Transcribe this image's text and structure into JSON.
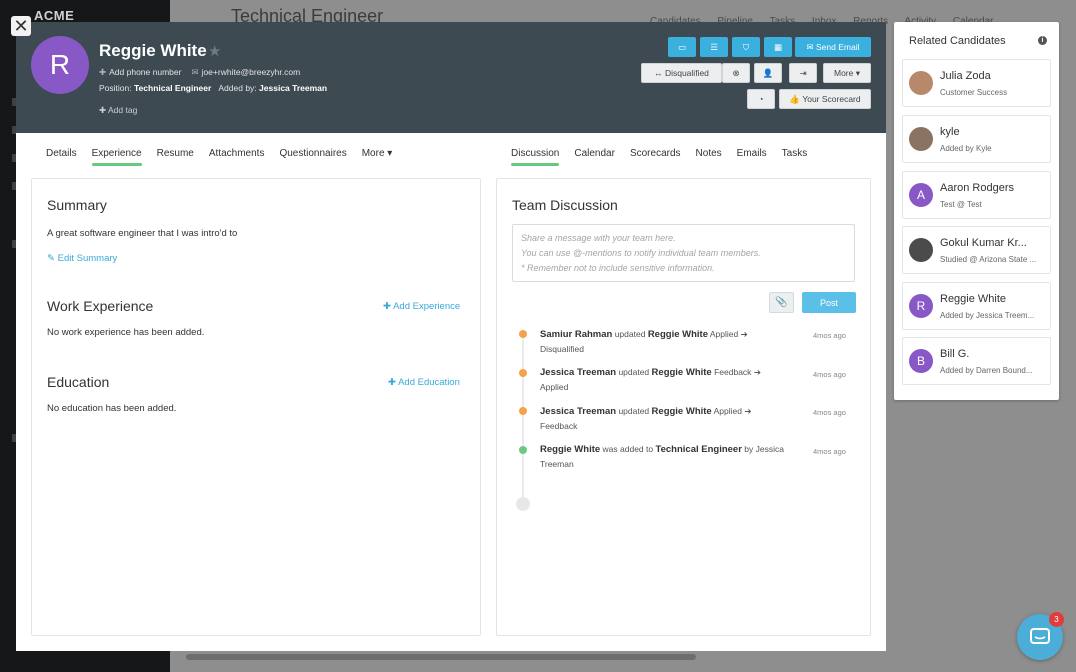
{
  "background": {
    "logo": "ACME",
    "page_title": "Technical Engineer",
    "nav": [
      "Candidates",
      "Pipeline",
      "Tasks",
      "Inbox",
      "Reports",
      "Activity",
      "Calendar"
    ]
  },
  "candidate": {
    "initial": "R",
    "name": "Reggie White",
    "phone_placeholder": "Add phone number",
    "email": "joe+rwhite@breezyhr.com",
    "position_label": "Position:",
    "position": "Technical Engineer",
    "added_by_label": "Added by:",
    "added_by": "Jessica Treeman",
    "add_tag": "Add tag"
  },
  "header_actions": {
    "send_email": "Send Email",
    "status": "Disqualified",
    "more": "More",
    "scorecard": "Your Scorecard"
  },
  "left_tabs": [
    {
      "label": "Details"
    },
    {
      "label": "Experience"
    },
    {
      "label": "Resume"
    },
    {
      "label": "Attachments"
    },
    {
      "label": "Questionnaires"
    },
    {
      "label": "More ▾"
    }
  ],
  "right_tabs": [
    {
      "label": "Discussion"
    },
    {
      "label": "Calendar"
    },
    {
      "label": "Scorecards"
    },
    {
      "label": "Notes"
    },
    {
      "label": "Emails"
    },
    {
      "label": "Tasks"
    }
  ],
  "summary": {
    "title": "Summary",
    "text": "A great software engineer that I was intro'd to",
    "edit_link": "Edit Summary"
  },
  "work_experience": {
    "title": "Work Experience",
    "add_link": "Add Experience",
    "empty": "No work experience has been added."
  },
  "education": {
    "title": "Education",
    "add_link": "Add Education",
    "empty": "No education has been added."
  },
  "discussion": {
    "title": "Team Discussion",
    "placeholder_lines": [
      "Share a message with your team here.",
      "You can use @-mentions to notify individual team members.",
      "* Remember not to include sensitive information."
    ],
    "post_label": "Post",
    "timeline": [
      {
        "actor": "Samiur Rahman",
        "verb": "updated",
        "subject": "Reggie White",
        "from": "Applied",
        "to": "Disqualified",
        "time": "4mos ago",
        "color": "#f5a24b"
      },
      {
        "actor": "Jessica Treeman",
        "verb": "updated",
        "subject": "Reggie White",
        "from": "Feedback",
        "to": "Applied",
        "time": "4mos ago",
        "color": "#f5a24b"
      },
      {
        "actor": "Jessica Treeman",
        "verb": "updated",
        "subject": "Reggie White",
        "from": "Applied",
        "to": "Feedback",
        "time": "4mos ago",
        "color": "#f5a24b"
      },
      {
        "actor": "Reggie White",
        "verb": "was added to",
        "subject": "Technical Engineer",
        "by": "by Jessica Treeman",
        "time": "4mos ago",
        "color": "#6cc985"
      }
    ]
  },
  "related": {
    "title": "Related Candidates",
    "items": [
      {
        "name": "Julia Zoda",
        "sub": "Customer Success",
        "initial": "",
        "color": "#b7896a"
      },
      {
        "name": "kyle",
        "sub": "Added by Kyle",
        "initial": "",
        "color": "#8a7461"
      },
      {
        "name": "Aaron Rodgers",
        "sub": "Test @ Test",
        "initial": "A",
        "color": "#8858c6"
      },
      {
        "name": "Gokul Kumar Kr...",
        "sub": "Studied @ Arizona State ...",
        "initial": "",
        "color": "#4b4b4b"
      },
      {
        "name": "Reggie White",
        "sub": "Added by Jessica Treem...",
        "initial": "R",
        "color": "#8858c6"
      },
      {
        "name": "Bill G.",
        "sub": "Added by Darren Bound...",
        "initial": "B",
        "color": "#8858c6"
      }
    ]
  },
  "chat": {
    "badge": "3"
  }
}
